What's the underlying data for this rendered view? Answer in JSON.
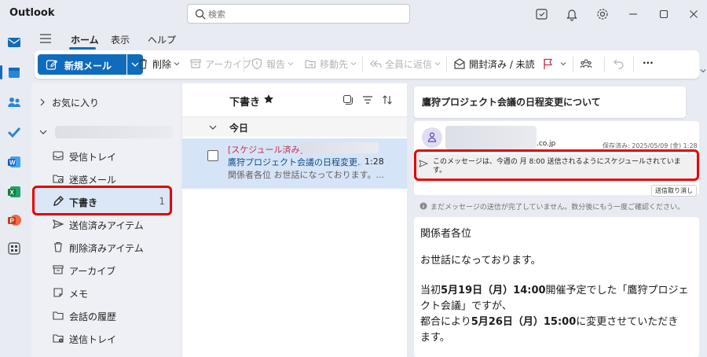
{
  "app": {
    "title": "Outlook"
  },
  "search": {
    "placeholder": "検索"
  },
  "ribbon": {
    "tabs": [
      "ホーム",
      "表示",
      "ヘルプ"
    ],
    "new_mail": "新規メール",
    "delete": "削除",
    "archive": "アーカイブ",
    "report": "報告",
    "move": "移動先",
    "reply_all": "全員に返信",
    "read_unread": "開封済み / 未読",
    "more": "···"
  },
  "folders": {
    "favorites": "お気に入り",
    "items": [
      {
        "label": "受信トレイ",
        "icon": "inbox-icon"
      },
      {
        "label": "迷惑メール",
        "icon": "junk-icon"
      },
      {
        "label": "下書き",
        "icon": "drafts-icon",
        "count": "1",
        "selected": true
      },
      {
        "label": "送信済みアイテム",
        "icon": "sent-icon"
      },
      {
        "label": "削除済みアイテム",
        "icon": "trash-icon"
      },
      {
        "label": "アーカイブ",
        "icon": "archive-icon"
      },
      {
        "label": "メモ",
        "icon": "notes-icon"
      },
      {
        "label": "会話の履歴",
        "icon": "folder-icon"
      },
      {
        "label": "送信トレイ",
        "icon": "outbox-icon"
      }
    ]
  },
  "list": {
    "title": "下書き",
    "group": "今日",
    "item": {
      "tag": "[スケジュール済み]",
      "subject": "鷹狩プロジェクト会議の日程変更...",
      "time": "1:28",
      "preview": "関係者各位 お世話になっております。..."
    }
  },
  "reading": {
    "subject": "鷹狩プロジェクト会議の日程変更について",
    "domain": ".co.jp",
    "saved": "保存済み: 2025/05/09 (金) 1:28",
    "notice": "このメッセージは、今週の 月 8:00 送信されるようにスケジュールされています。",
    "cancel": "送信取り消し",
    "info": "まだメッセージの送信が完了していません。数分後にもう一度ご確認ください。",
    "body": {
      "p1": "関係者各位",
      "p2": "お世話になっております。",
      "p3_a": "当初",
      "p3_b": "5月19日（月）14:00",
      "p3_c": "開催予定でした「鷹狩プロジェ",
      "p3_d": "クト会議」ですが、",
      "p4_a": "都合により",
      "p4_b": "5月26日（月）15:00",
      "p4_c": "に変更させていただき",
      "p4_d": "ます。"
    }
  },
  "colors": {
    "accent": "#0f6cbd",
    "highlight": "#e60000",
    "scheduled": "#c4314b"
  }
}
